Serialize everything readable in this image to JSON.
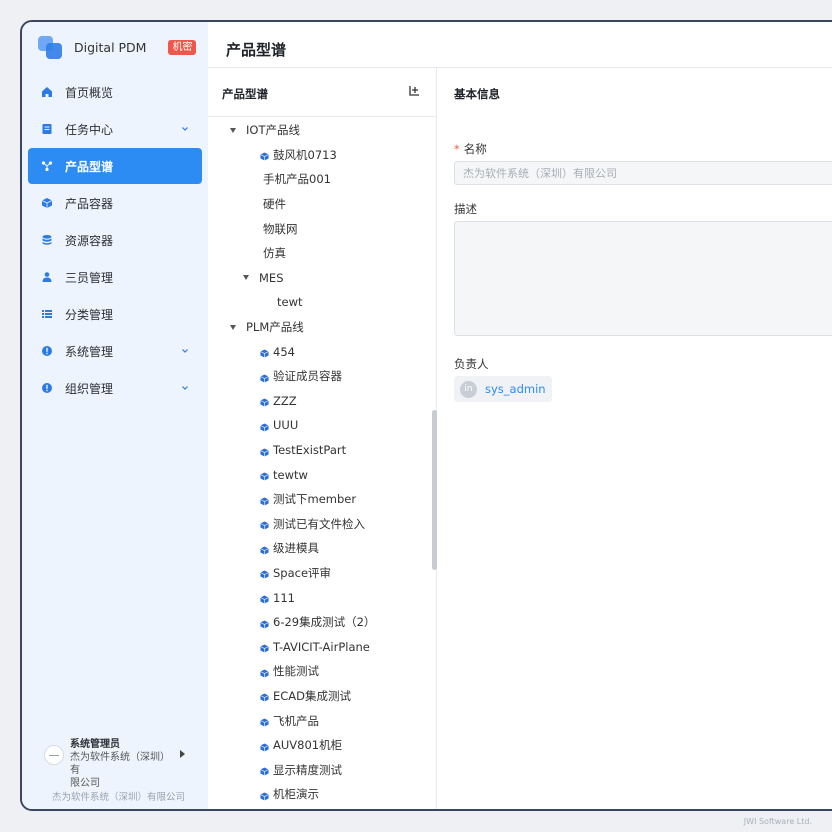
{
  "brand": {
    "name": "Digital PDM",
    "badge": "机密"
  },
  "nav": [
    {
      "label": "首页概览",
      "icon": "home-icon",
      "expandable": false,
      "active": false
    },
    {
      "label": "任务中心",
      "icon": "task-icon",
      "expandable": true,
      "active": false
    },
    {
      "label": "产品型谱",
      "icon": "product-spectrum-icon",
      "expandable": false,
      "active": true
    },
    {
      "label": "产品容器",
      "icon": "cube-icon",
      "expandable": false,
      "active": false
    },
    {
      "label": "资源容器",
      "icon": "database-icon",
      "expandable": false,
      "active": false
    },
    {
      "label": "三员管理",
      "icon": "users-icon",
      "expandable": false,
      "active": false
    },
    {
      "label": "分类管理",
      "icon": "list-icon",
      "expandable": false,
      "active": false
    },
    {
      "label": "系统管理",
      "icon": "info-icon",
      "expandable": true,
      "active": false
    },
    {
      "label": "组织管理",
      "icon": "info-icon",
      "expandable": true,
      "active": false
    }
  ],
  "user": {
    "name": "系统管理员",
    "company_line1": "杰为软件系统（深圳）有",
    "company_line2": "限公司"
  },
  "footer_company": "杰为软件系统（深圳）有限公司",
  "page_title": "产品型谱",
  "tree_panel": {
    "title": "产品型谱",
    "rows": [
      {
        "label": "IOT产品线",
        "level": 0,
        "caret": true,
        "icon": false
      },
      {
        "label": "鼓风机0713",
        "level": 1,
        "caret": false,
        "icon": true
      },
      {
        "label": "手机产品001",
        "level": 1,
        "caret": false,
        "icon": false
      },
      {
        "label": "硬件",
        "level": 1,
        "caret": false,
        "icon": false
      },
      {
        "label": "物联网",
        "level": 1,
        "caret": false,
        "icon": false
      },
      {
        "label": "仿真",
        "level": 1,
        "caret": false,
        "icon": false
      },
      {
        "label": "MES",
        "level": 1,
        "caret": true,
        "icon": false
      },
      {
        "label": "tewt",
        "level": 2,
        "caret": false,
        "icon": false
      },
      {
        "label": "PLM产品线",
        "level": 0,
        "caret": true,
        "icon": false
      },
      {
        "label": "454",
        "level": 1,
        "caret": false,
        "icon": true
      },
      {
        "label": "验证成员容器",
        "level": 1,
        "caret": false,
        "icon": true
      },
      {
        "label": "ZZZ",
        "level": 1,
        "caret": false,
        "icon": true
      },
      {
        "label": "UUU",
        "level": 1,
        "caret": false,
        "icon": true
      },
      {
        "label": "TestExistPart",
        "level": 1,
        "caret": false,
        "icon": true
      },
      {
        "label": "tewtw",
        "level": 1,
        "caret": false,
        "icon": true
      },
      {
        "label": "测试下member",
        "level": 1,
        "caret": false,
        "icon": true
      },
      {
        "label": "测试已有文件检入",
        "level": 1,
        "caret": false,
        "icon": true
      },
      {
        "label": "级进模具",
        "level": 1,
        "caret": false,
        "icon": true
      },
      {
        "label": "Space评审",
        "level": 1,
        "caret": false,
        "icon": true
      },
      {
        "label": "111",
        "level": 1,
        "caret": false,
        "icon": true
      },
      {
        "label": "6-29集成测试（2）",
        "level": 1,
        "caret": false,
        "icon": true
      },
      {
        "label": "T-AVICIT-AirPlane",
        "level": 1,
        "caret": false,
        "icon": true
      },
      {
        "label": "性能测试",
        "level": 1,
        "caret": false,
        "icon": true
      },
      {
        "label": "ECAD集成测试",
        "level": 1,
        "caret": false,
        "icon": true
      },
      {
        "label": "飞机产品",
        "level": 1,
        "caret": false,
        "icon": true
      },
      {
        "label": "AUV801机柜",
        "level": 1,
        "caret": false,
        "icon": true
      },
      {
        "label": "显示精度测试",
        "level": 1,
        "caret": false,
        "icon": true
      },
      {
        "label": "机柜演示",
        "level": 1,
        "caret": false,
        "icon": true
      }
    ]
  },
  "info": {
    "title": "基本信息",
    "name_label": "名称",
    "name_value": "杰为软件系统（深圳）有限公司",
    "desc_label": "描述",
    "owner_label": "负责人",
    "owner_initials": "in",
    "owner_name": "sys_admin"
  },
  "watermark": "JWI Software Ltd.",
  "colors": {
    "accent": "#2c8cf4",
    "sidebar_bg": "#edf4fd",
    "badge": "#f0564a"
  }
}
